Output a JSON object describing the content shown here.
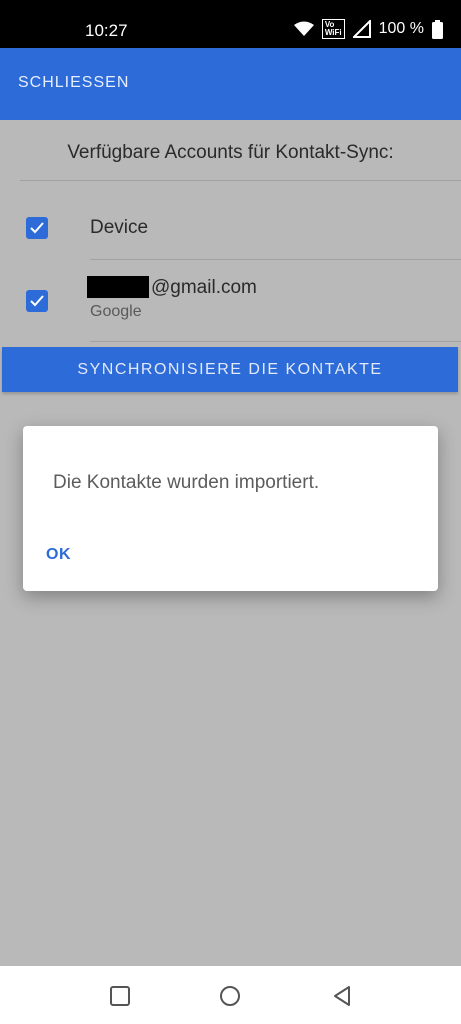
{
  "status": {
    "time": "10:27",
    "vowifi": "Vo\nWiFi",
    "battery": "100 %",
    "icons": [
      "wifi-icon",
      "vowifi-icon",
      "signal-icon",
      "battery-icon"
    ]
  },
  "app_bar": {
    "close_label": "SCHLIESSEN",
    "color": "#2d6bd8"
  },
  "main": {
    "heading": "Verfügbare Accounts für Kontakt-Sync:",
    "accounts": [
      {
        "label": "Device",
        "sub": "",
        "checked": true
      },
      {
        "label": "@gmail.com",
        "sub": "Google",
        "checked": true
      }
    ],
    "sync_button": "SYNCHRONISIERE DIE KONTAKTE"
  },
  "dialog": {
    "message": "Die Kontakte wurden importiert.",
    "ok_label": "OK"
  },
  "nav": {
    "icons": [
      "recents-icon",
      "home-icon",
      "back-icon"
    ]
  }
}
